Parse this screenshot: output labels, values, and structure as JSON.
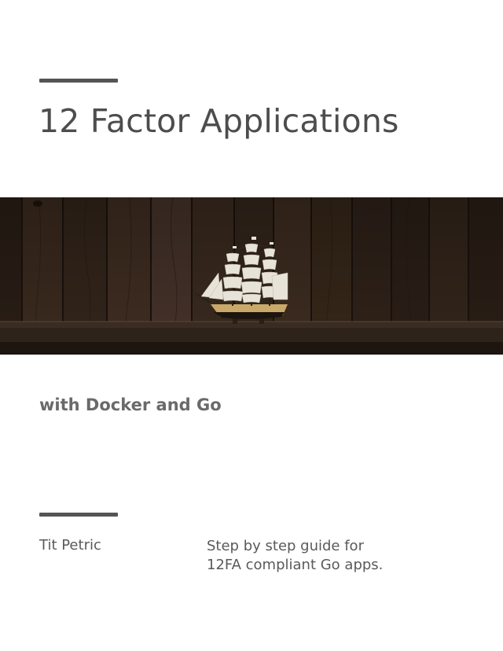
{
  "cover": {
    "title": "12 Factor Applications",
    "subtitle": "with Docker and Go",
    "author": "Tit Petric",
    "tagline_lines": [
      "Step by step guide for",
      "12FA compliant Go apps."
    ]
  },
  "image": {
    "subject": "model sailing ship on a dark wooden shelf",
    "colors": {
      "wood_dark": "#241a13",
      "wood_mid": "#3a2a1f",
      "wood_light": "#4a3628",
      "shelf": "#2e231b",
      "hull": "#c9a86a",
      "sail": "#e8e3d8"
    }
  },
  "accent_colors": {
    "rule": "#555555",
    "title_text": "#4d4d4d",
    "body_text": "#5a5a5a"
  }
}
